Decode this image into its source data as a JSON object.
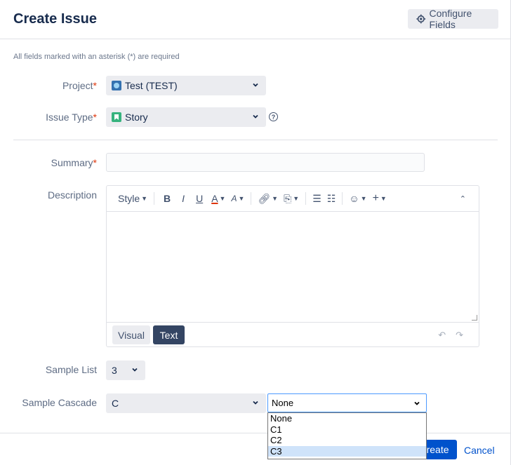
{
  "dialog": {
    "title": "Create Issue",
    "configure_fields_label": "Configure Fields",
    "required_note": "All fields marked with an asterisk (*) are required"
  },
  "fields": {
    "project": {
      "label": "Project",
      "required_mark": "*",
      "value": "Test (TEST)",
      "icon": "project-avatar-icon"
    },
    "issue_type": {
      "label": "Issue Type",
      "required_mark": "*",
      "value": "Story",
      "icon": "story-icon"
    },
    "summary": {
      "label": "Summary",
      "required_mark": "*",
      "value": ""
    },
    "description": {
      "label": "Description",
      "toolbar": {
        "style_label": "Style",
        "bold": "B",
        "italic": "I",
        "underline": "U",
        "text_color": "A",
        "more_format": "A"
      },
      "mode_visual": "Visual",
      "mode_text": "Text"
    },
    "sample_list": {
      "label": "Sample List",
      "value": "3"
    },
    "sample_cascade": {
      "label": "Sample Cascade",
      "parent_value": "C",
      "child_value": "None",
      "child_options": [
        "None",
        "C1",
        "C2",
        "C3"
      ],
      "highlighted_option": "C3"
    }
  },
  "footer": {
    "create_label": "Create",
    "cancel_label": "Cancel"
  },
  "colors": {
    "primary": "#0052cc",
    "required": "#de350b",
    "field_bg": "#ebecf0",
    "text_mode_bg": "#344563"
  }
}
